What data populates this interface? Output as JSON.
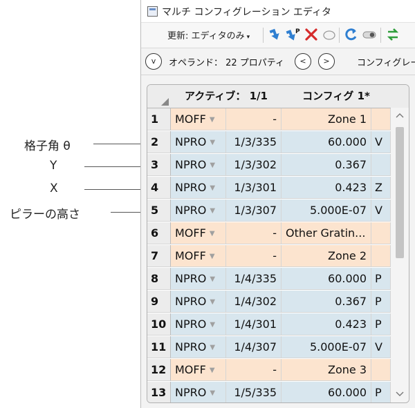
{
  "annotations": [
    {
      "label": "格子角 θ"
    },
    {
      "label": "Y"
    },
    {
      "label": "X"
    },
    {
      "label": "ピラーの高さ"
    }
  ],
  "window": {
    "title": "マルチ コンフィグレーション エディタ"
  },
  "toolbar": {
    "update_label": "更新: エディタのみ",
    "update_caret": "▾",
    "icons": [
      "insert-config-icon",
      "insert-config-pickup-icon",
      "delete-config-icon",
      "ellipse-icon",
      "refresh-icon",
      "toggle-icon",
      "sort-icon"
    ]
  },
  "navbar": {
    "collapse_glyph": "v",
    "operand_label": "オペランド： 22 プロパティ",
    "prev_glyph": "<",
    "next_glyph": ">",
    "config_label": "コンフィグレー"
  },
  "grid": {
    "headers": {
      "active": "アクティブ： 1/1",
      "config": "コンフィグ 1*"
    },
    "colors": {
      "moff_bg": "#fce4cf",
      "npro_bg": "#d8e6ee"
    },
    "rows": [
      {
        "num": "1",
        "op": "MOFF",
        "param": "-",
        "value": "Zone 1",
        "flag": "",
        "kind": "moff"
      },
      {
        "num": "2",
        "op": "NPRO",
        "param": "1/3/335",
        "value": "60.000",
        "flag": "V",
        "kind": "npro"
      },
      {
        "num": "3",
        "op": "NPRO",
        "param": "1/3/302",
        "value": "0.367",
        "flag": "",
        "kind": "npro"
      },
      {
        "num": "4",
        "op": "NPRO",
        "param": "1/3/301",
        "value": "0.423",
        "flag": "Z",
        "kind": "npro"
      },
      {
        "num": "5",
        "op": "NPRO",
        "param": "1/3/307",
        "value": "5.000E-07",
        "flag": "V",
        "kind": "npro"
      },
      {
        "num": "6",
        "op": "MOFF",
        "param": "-",
        "value": "Other Gratin...",
        "flag": "",
        "kind": "moff"
      },
      {
        "num": "7",
        "op": "MOFF",
        "param": "-",
        "value": "Zone 2",
        "flag": "",
        "kind": "moff"
      },
      {
        "num": "8",
        "op": "NPRO",
        "param": "1/4/335",
        "value": "60.000",
        "flag": "P",
        "kind": "npro"
      },
      {
        "num": "9",
        "op": "NPRO",
        "param": "1/4/302",
        "value": "0.367",
        "flag": "P",
        "kind": "npro"
      },
      {
        "num": "10",
        "op": "NPRO",
        "param": "1/4/301",
        "value": "0.423",
        "flag": "P",
        "kind": "npro"
      },
      {
        "num": "11",
        "op": "NPRO",
        "param": "1/4/307",
        "value": "5.000E-07",
        "flag": "V",
        "kind": "npro"
      },
      {
        "num": "12",
        "op": "MOFF",
        "param": "-",
        "value": "Zone 3",
        "flag": "",
        "kind": "moff"
      },
      {
        "num": "13",
        "op": "NPRO",
        "param": "1/5/335",
        "value": "60.000",
        "flag": "P",
        "kind": "npro"
      }
    ]
  }
}
